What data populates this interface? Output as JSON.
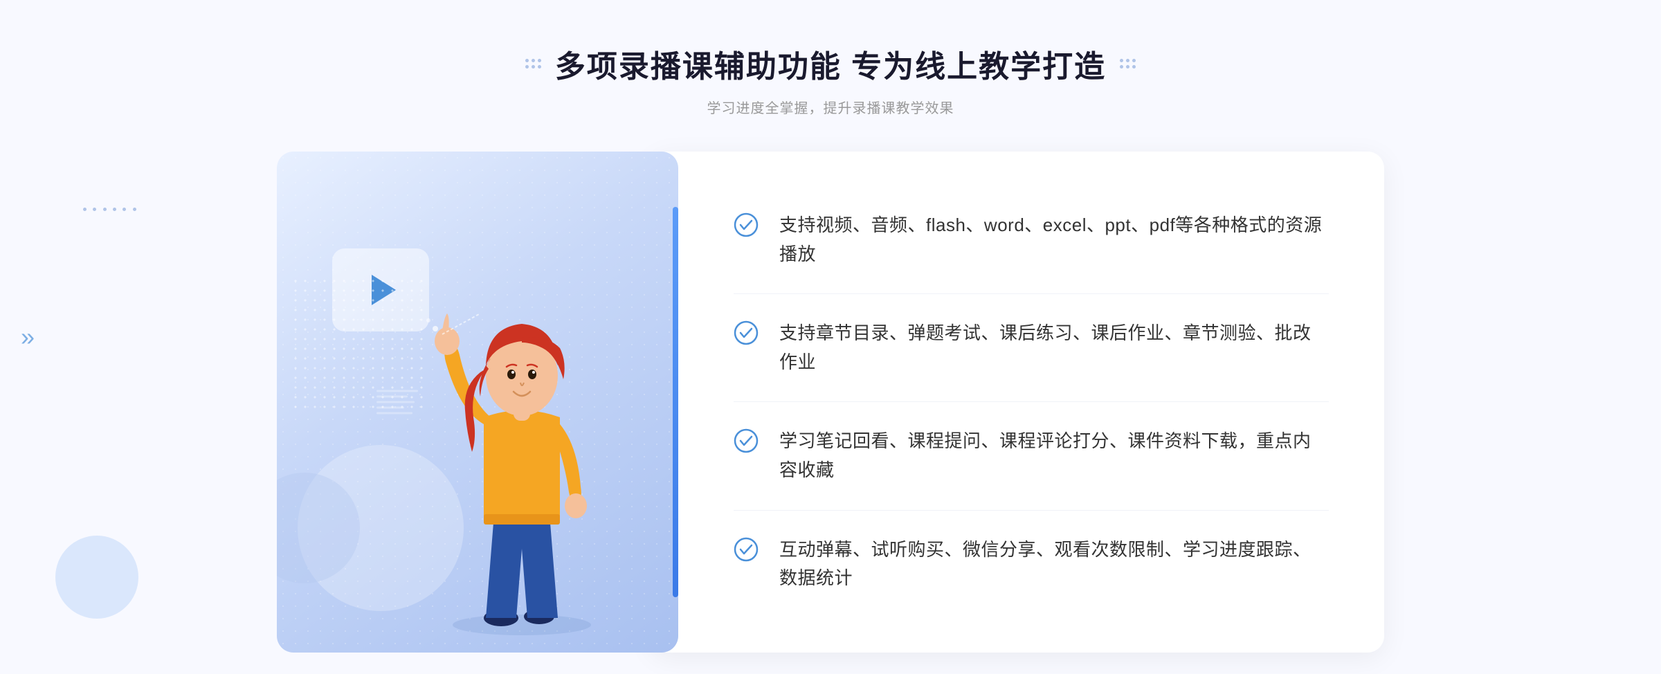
{
  "header": {
    "title": "多项录播课辅助功能 专为线上教学打造",
    "subtitle": "学习进度全掌握，提升录播课教学效果"
  },
  "features": [
    {
      "id": "feature-1",
      "text": "支持视频、音频、flash、word、excel、ppt、pdf等各种格式的资源播放"
    },
    {
      "id": "feature-2",
      "text": "支持章节目录、弹题考试、课后练习、课后作业、章节测验、批改作业"
    },
    {
      "id": "feature-3",
      "text": "学习笔记回看、课程提问、课程评论打分、课件资料下载，重点内容收藏"
    },
    {
      "id": "feature-4",
      "text": "互动弹幕、试听购买、微信分享、观看次数限制、学习进度跟踪、数据统计"
    }
  ],
  "colors": {
    "primary": "#3a7ae8",
    "title": "#1a1a2e",
    "subtitle": "#999999",
    "text": "#333333",
    "check": "#4a90d9",
    "bg": "#f8f9ff"
  },
  "decorations": {
    "left_arrow": "»",
    "title_deco_left": "⁞",
    "title_deco_right": "⁞"
  }
}
